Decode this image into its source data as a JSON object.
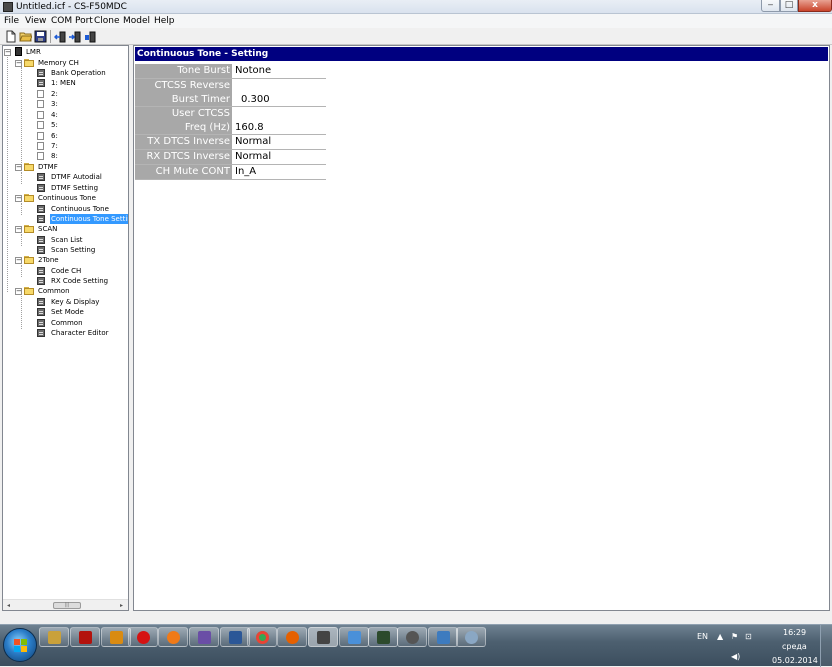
{
  "window": {
    "title": "Untitled.icf - CS-F50MDC",
    "minimize_glyph": "‒",
    "maximize_glyph": "□",
    "close_glyph": "x"
  },
  "menu": {
    "items": [
      {
        "label": "File",
        "key": "file"
      },
      {
        "label": "View",
        "key": "view"
      },
      {
        "label": "COM Port",
        "key": "com-port"
      },
      {
        "label": "Clone",
        "key": "clone"
      },
      {
        "label": "Model",
        "key": "model"
      },
      {
        "label": "Help",
        "key": "help"
      }
    ]
  },
  "toolbar": {
    "icons": [
      "new-file-icon",
      "open-folder-icon",
      "save-icon",
      "read-from-radio-icon",
      "write-to-radio-icon",
      "radio-clone-icon"
    ]
  },
  "tree": {
    "root": "LMR",
    "memory_ch": {
      "label": "Memory CH",
      "items": [
        "Bank Operation",
        "1: MEN",
        "2:",
        "3:",
        "4:",
        "5:",
        "6:",
        "7:",
        "8:"
      ]
    },
    "dtmf": {
      "label": "DTMF",
      "items": [
        "DTMF Autodial",
        "DTMF Setting"
      ]
    },
    "continuous_tone": {
      "label": "Continuous Tone",
      "items": [
        "Continuous Tone",
        "Continuous Tone Setting"
      ]
    },
    "scan": {
      "label": "SCAN",
      "items": [
        "Scan List",
        "Scan Setting"
      ]
    },
    "two_tone": {
      "label": "2Tone",
      "items": [
        "Code CH",
        "RX Code Setting"
      ]
    },
    "common": {
      "label": "Common",
      "items": [
        "Key & Display",
        "Set Mode",
        "Common",
        "Character Editor"
      ]
    },
    "expander_minus": "−",
    "scroll_left": "◂",
    "scroll_right": "▸",
    "scroll_grip": "|||"
  },
  "panel": {
    "header": "Continuous Tone - Setting",
    "settings": [
      {
        "label": "Tone Burst",
        "value": "Notone"
      },
      {
        "label_lines": [
          "CTCSS Reverse",
          "Burst Timer"
        ],
        "value": "0.300"
      },
      {
        "label_lines": [
          "User CTCSS",
          "Freq (Hz)"
        ],
        "value": "160.8"
      },
      {
        "label": "TX DTCS Inverse",
        "value": "Normal"
      },
      {
        "label": "RX DTCS Inverse",
        "value": "Normal"
      },
      {
        "label": "CH Mute CONT",
        "value": "In_A"
      }
    ]
  },
  "taskbar": {
    "apps": [
      "explorer",
      "acrobat",
      "winamp",
      "opera",
      "app-orange",
      "paint-brush",
      "word",
      "chrome",
      "firefox",
      "cs-f50mdc",
      "remote-desktop",
      "terminal",
      "headset-app",
      "network-app",
      "speedometer-app"
    ],
    "tray": {
      "language": "EN",
      "time": "16:29",
      "day": "среда",
      "date": "05.02.2014"
    }
  },
  "colors": {
    "header_bg": "#000080",
    "label_bg": "#a8a8a8",
    "selection": "#3399ff"
  }
}
